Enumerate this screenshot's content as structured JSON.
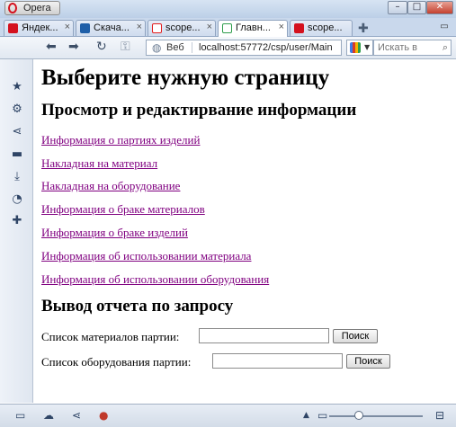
{
  "window": {
    "app_button": "Opera",
    "minimize_glyph": "–",
    "maximize_glyph": "□",
    "close_glyph": "✕"
  },
  "tabs": [
    {
      "label": "Яндек...",
      "icon": "opera-icon",
      "color": "#d4111e"
    },
    {
      "label": "Скача...",
      "icon": "t-icon",
      "color": "#1f5fa8"
    },
    {
      "label": "scope...",
      "icon": "yandex-icon",
      "color": "#e31b1b"
    },
    {
      "label": "Главн...",
      "icon": "page-icon",
      "color": "#2e9d4c"
    },
    {
      "label": "scope...",
      "icon": "opera-icon",
      "color": "#d4111e"
    }
  ],
  "tab_close_glyph": "×",
  "address": {
    "prefix": "Веб",
    "url": "localhost:57772/csp/user/Main"
  },
  "search": {
    "placeholder": "Искать в"
  },
  "page": {
    "title": "Выберите нужную страницу",
    "section1": "Просмотр и редактирвание информации",
    "links": [
      "Информация о партиях изделий",
      "Накладная на материал",
      "Накладная на оборудование",
      "Информация о браке материалов",
      "Информация о браке изделий",
      "Информация об использовании материала",
      "Информация об использовании оборудования"
    ],
    "section2": "Вывод отчета по запросу",
    "query1_label": "Список материалов партии:",
    "query2_label": "Список оборудования партии:",
    "search_button": "Поиск"
  },
  "colors": {
    "link_visited": "#800080",
    "panel_icon": "#2f4566"
  }
}
